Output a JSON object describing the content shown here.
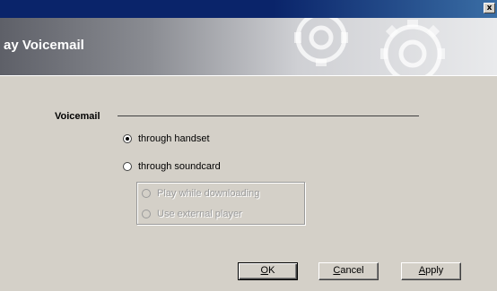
{
  "window": {
    "close_glyph": "x"
  },
  "banner": {
    "title": "ay Voicemail"
  },
  "voicemail": {
    "section_label": "Voicemail",
    "options": [
      {
        "label": "through handset",
        "checked": true,
        "enabled": true
      },
      {
        "label": "through soundcard",
        "checked": false,
        "enabled": true
      }
    ],
    "soundcard_options": [
      {
        "label": "Play while downloading",
        "checked": false,
        "enabled": false
      },
      {
        "label": "Use external player",
        "checked": false,
        "enabled": false
      }
    ]
  },
  "buttons": {
    "ok": {
      "accel": "O",
      "rest": "K"
    },
    "cancel": {
      "accel": "C",
      "rest": "ancel"
    },
    "apply": {
      "accel": "A",
      "rest": "pply"
    }
  },
  "colors": {
    "titlebar": "#0a246a",
    "dialog_bg": "#d4d0c8",
    "disabled_text": "#9a9a9a"
  }
}
